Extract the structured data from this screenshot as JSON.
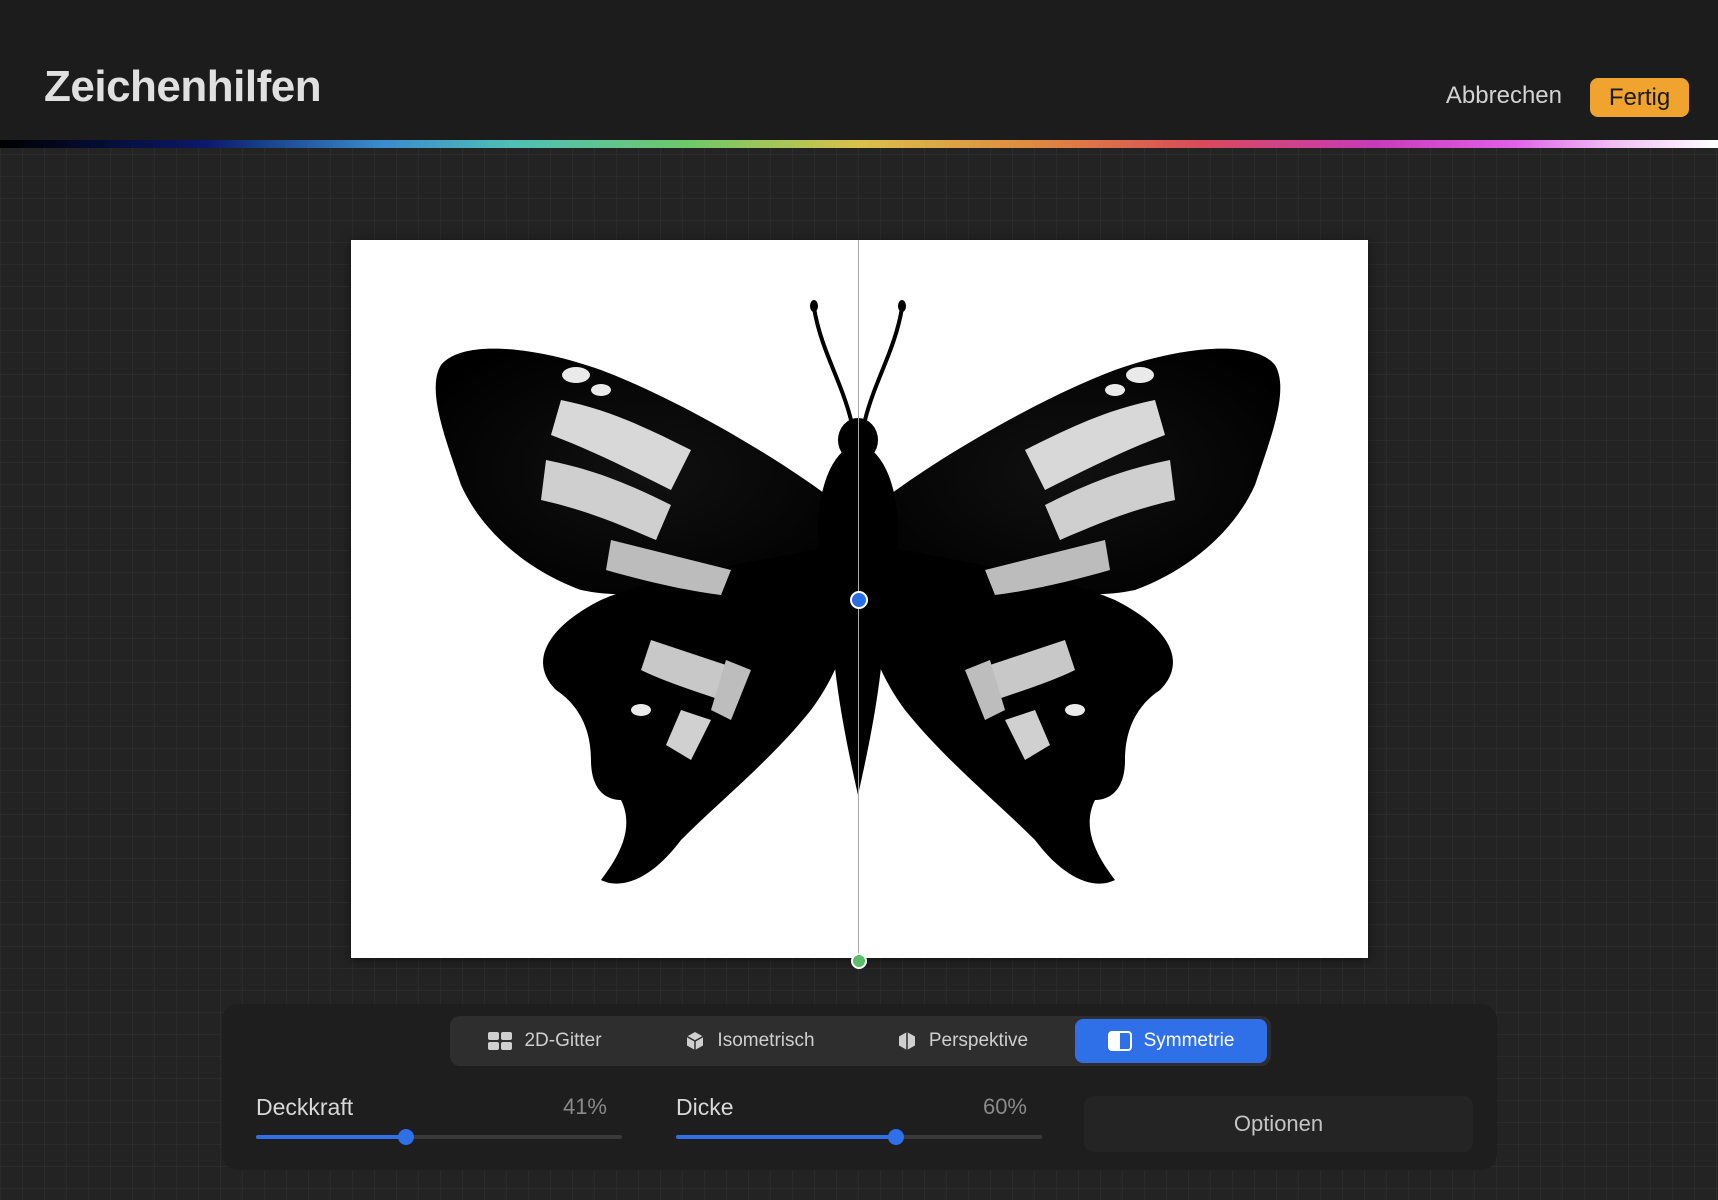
{
  "header": {
    "title": "Zeichenhilfen",
    "cancel_label": "Abbrechen",
    "done_label": "Fertig"
  },
  "colors": {
    "accent": "#2f6fe8",
    "done_button": "#f0a42f",
    "background": "#232323"
  },
  "segments": [
    {
      "label": "2D-Gitter",
      "icon": "grid-2d-icon",
      "active": false
    },
    {
      "label": "Isometrisch",
      "icon": "isometric-cube-icon",
      "active": false
    },
    {
      "label": "Perspektive",
      "icon": "perspective-cube-icon",
      "active": false
    },
    {
      "label": "Symmetrie",
      "icon": "symmetry-icon",
      "active": true
    }
  ],
  "sliders": {
    "opacity": {
      "label": "Deckkraft",
      "value_text": "41%",
      "value": 0.41
    },
    "thickness": {
      "label": "Dicke",
      "value_text": "60%",
      "value": 0.6
    }
  },
  "options_label": "Optionen"
}
